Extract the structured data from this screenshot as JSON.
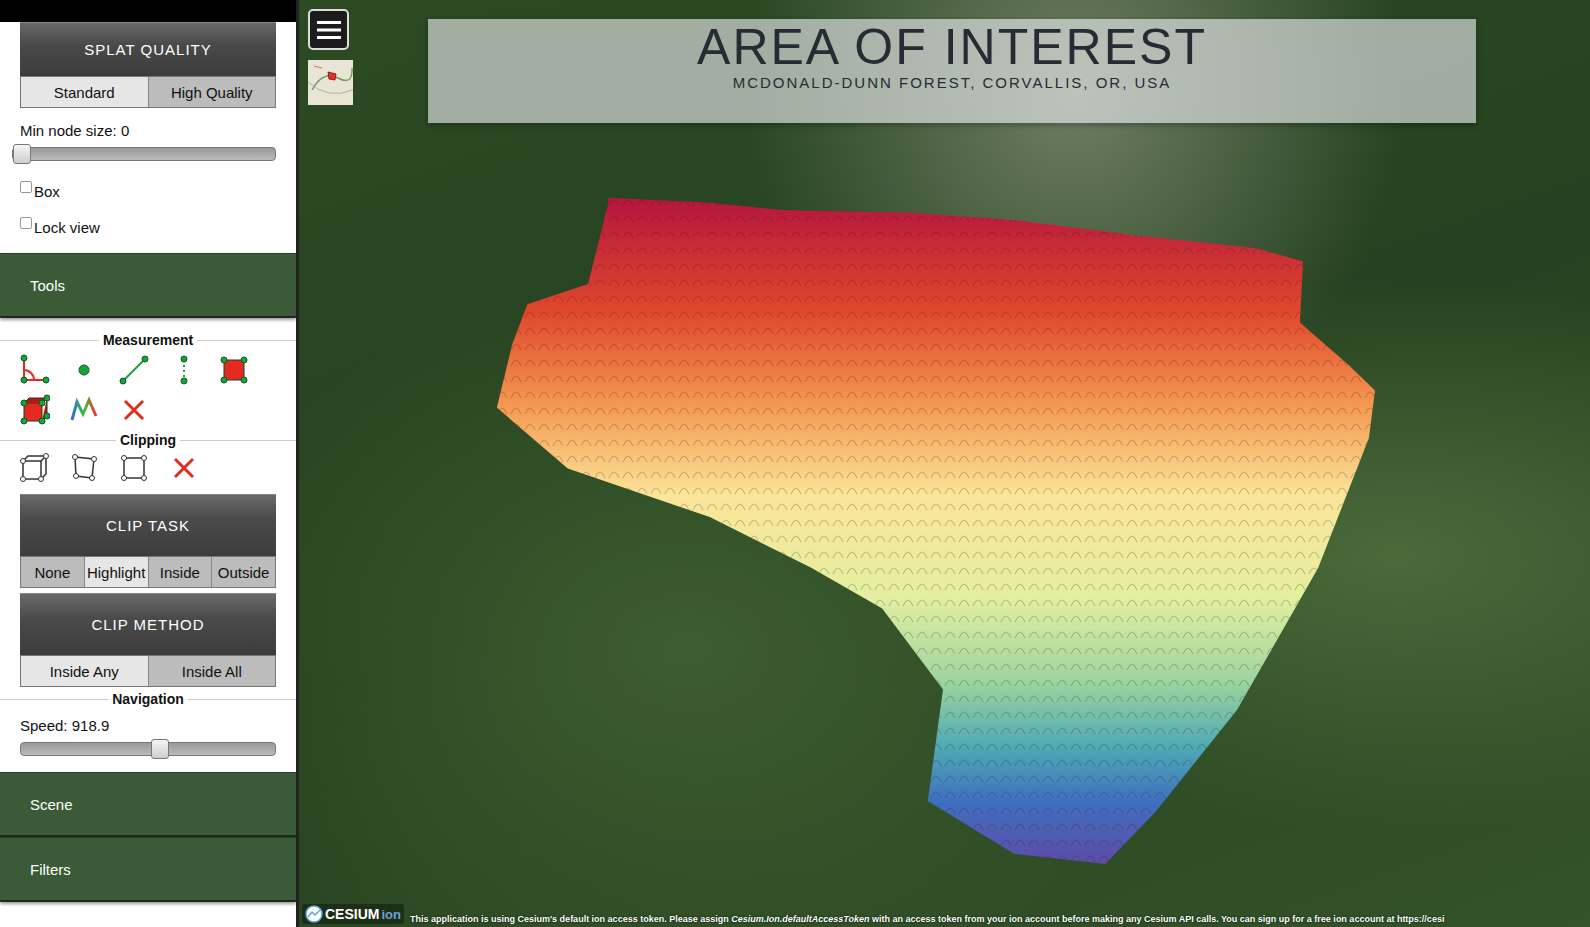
{
  "sidebar": {
    "splat_quality": {
      "title": "SPLAT QUALITY",
      "options": [
        {
          "label": "Standard",
          "selected": true
        },
        {
          "label": "High Quality",
          "selected": false
        }
      ]
    },
    "min_node_size": {
      "label": "Min node size: 0",
      "level": 0
    },
    "checkboxes": [
      {
        "label": "Box",
        "checked": false
      },
      {
        "label": "Lock view",
        "checked": false
      }
    ],
    "tools_section": {
      "title": "Tools"
    },
    "measurement": {
      "title": "Measurement"
    },
    "clipping": {
      "title": "Clipping"
    },
    "clip_task": {
      "title": "CLIP TASK",
      "options": [
        {
          "label": "None",
          "selected": false
        },
        {
          "label": "Highlight",
          "selected": true
        },
        {
          "label": "Inside",
          "selected": false
        },
        {
          "label": "Outside",
          "selected": false
        }
      ]
    },
    "clip_method": {
      "title": "CLIP METHOD",
      "options": [
        {
          "label": "Inside Any",
          "selected": true
        },
        {
          "label": "Inside All",
          "selected": false
        }
      ]
    },
    "navigation": {
      "title": "Navigation",
      "speed": {
        "label": "Speed: 918.9",
        "level": 0.55
      }
    },
    "sections": [
      {
        "title": "Scene"
      },
      {
        "title": "Filters"
      }
    ]
  },
  "banner": {
    "title": "AREA OF INTEREST",
    "subtitle": "MCDONALD-DUNN FOREST, CORVALLIS, OR, USA"
  },
  "credits": {
    "logo": "CESIUM",
    "logo_suffix": "ion",
    "notice": [
      {
        "text": "This application is using Cesium's default ion access token. Please assign ",
        "italic": false
      },
      {
        "text": "Cesium.Ion.defaultAccessToken",
        "italic": true
      },
      {
        "text": " with an access token from your ion account before making any Cesium API calls. You can sign up for a free ion account at https://cesi",
        "italic": false
      }
    ]
  }
}
